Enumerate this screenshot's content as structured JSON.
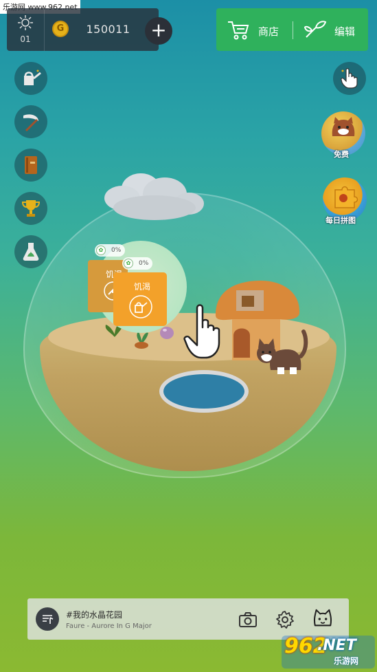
{
  "watermark_top": "乐游网 www.962.net",
  "hud": {
    "day_number": "01",
    "coin_symbol": "G",
    "coins": "150011",
    "plus_label": "+"
  },
  "shop": {
    "shop_label": "商店",
    "edit_label": "编辑"
  },
  "right_bubbles": {
    "free_label": "免费",
    "daily_puzzle_label": "每日拼图"
  },
  "plant_status": {
    "back_card": {
      "percent": "0%",
      "title": "饥渴"
    },
    "front_card": {
      "percent": "0%",
      "title": "饥渴"
    }
  },
  "music": {
    "title": "#我的水晶花园",
    "subtitle": "Faure - Aurore In G Major"
  },
  "watermark_bottom": {
    "number": "962",
    "suffix": ".NET",
    "sub": "乐游网"
  },
  "colors": {
    "shop_green": "#2fb15c",
    "coin_gold": "#e6b21a",
    "card_orange": "#f3a12a"
  }
}
